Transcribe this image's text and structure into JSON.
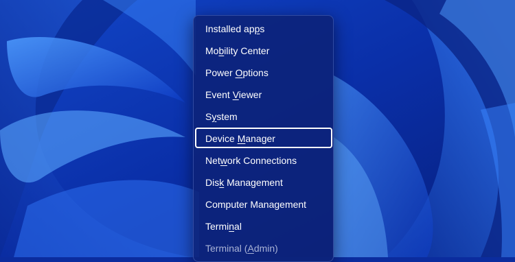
{
  "menu": {
    "items": [
      {
        "label": "Installed apps",
        "access_key": "p",
        "access_index": 12,
        "state": "normal"
      },
      {
        "label": "Mobility Center",
        "access_key": "b",
        "access_index": 2,
        "state": "normal"
      },
      {
        "label": "Power Options",
        "access_key": "O",
        "access_index": 6,
        "state": "normal"
      },
      {
        "label": "Event Viewer",
        "access_key": "V",
        "access_index": 6,
        "state": "normal"
      },
      {
        "label": "System",
        "access_key": "y",
        "access_index": 1,
        "state": "normal"
      },
      {
        "label": "Device Manager",
        "access_key": "M",
        "access_index": 7,
        "state": "focused"
      },
      {
        "label": "Network Connections",
        "access_key": "w",
        "access_index": 3,
        "state": "normal"
      },
      {
        "label": "Disk Management",
        "access_key": "k",
        "access_index": 3,
        "state": "normal"
      },
      {
        "label": "Computer Management",
        "access_key": "",
        "access_index": -1,
        "state": "normal"
      },
      {
        "label": "Terminal",
        "access_key": "i",
        "access_index": 5,
        "state": "normal"
      },
      {
        "label": "Terminal (Admin)",
        "access_key": "A",
        "access_index": 10,
        "state": "dim"
      }
    ]
  },
  "colors": {
    "menu_background": "#0c2278",
    "menu_text": "#ffffff",
    "focus_border": "#ffffff",
    "wallpaper_dark": "#06217f",
    "wallpaper_light": "#3f8cff"
  }
}
